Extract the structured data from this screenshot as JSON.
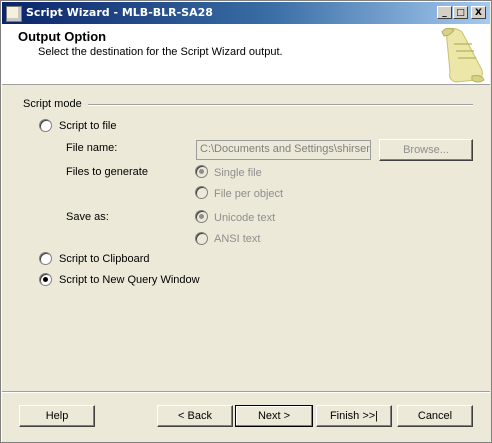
{
  "window": {
    "title": "Script Wizard - MLB-BLR-SA28",
    "minimize": "_",
    "maximize": "□",
    "close": "X"
  },
  "header": {
    "title": "Output Option",
    "subtitle": "Select the destination for the Script Wizard output."
  },
  "script_mode": {
    "group_label": "Script mode",
    "script_to_file": "Script to file",
    "file_name_label": "File name:",
    "file_name_value": "C:\\Documents and Settings\\shirsen",
    "browse": "Browse...",
    "files_to_generate_label": "Files to generate",
    "single_file": "Single file",
    "file_per_object": "File per object",
    "save_as_label": "Save as:",
    "unicode_text": "Unicode text",
    "ansi_text": "ANSI text",
    "script_to_clipboard": "Script to Clipboard",
    "script_to_new_query_window": "Script to New Query Window"
  },
  "footer": {
    "help": "Help",
    "back": "< Back",
    "next": "Next >",
    "finish": "Finish >>|",
    "cancel": "Cancel"
  }
}
